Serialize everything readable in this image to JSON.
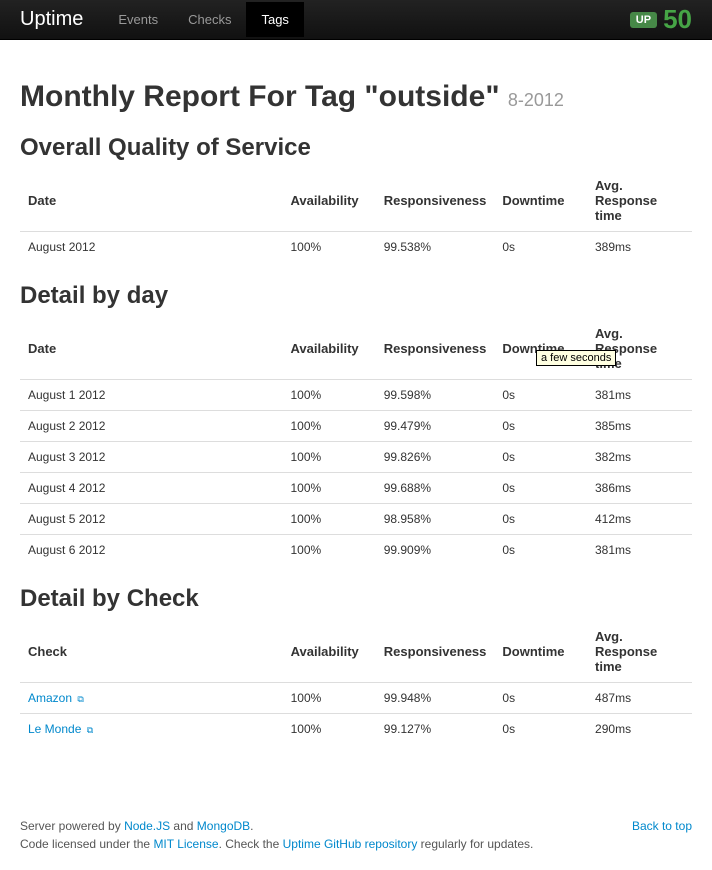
{
  "navbar": {
    "brand": "Uptime",
    "items": [
      {
        "label": "Events",
        "active": false
      },
      {
        "label": "Checks",
        "active": false
      },
      {
        "label": "Tags",
        "active": true
      }
    ],
    "status_badge": "UP",
    "count": "50"
  },
  "heading": {
    "title_prefix": "Monthly Report For Tag \"",
    "tag_name": "outside",
    "title_suffix": "\"",
    "period": "8-2012"
  },
  "sections": {
    "overall": {
      "title": "Overall Quality of Service",
      "columns": [
        "Date",
        "Availability",
        "Responsiveness",
        "Downtime",
        "Avg. Response time"
      ],
      "rows": [
        {
          "c0": "August 2012",
          "c1": "100%",
          "c2": "99.538%",
          "c3": "0s",
          "c4": "389ms"
        }
      ]
    },
    "byday": {
      "title": "Detail by day",
      "columns": [
        "Date",
        "Availability",
        "Responsiveness",
        "Downtime",
        "Avg. Response time"
      ],
      "rows": [
        {
          "c0": "August 1 2012",
          "c1": "100%",
          "c2": "99.598%",
          "c3": "0s",
          "c4": "381ms"
        },
        {
          "c0": "August 2 2012",
          "c1": "100%",
          "c2": "99.479%",
          "c3": "0s",
          "c4": "385ms"
        },
        {
          "c0": "August 3 2012",
          "c1": "100%",
          "c2": "99.826%",
          "c3": "0s",
          "c4": "382ms"
        },
        {
          "c0": "August 4 2012",
          "c1": "100%",
          "c2": "99.688%",
          "c3": "0s",
          "c4": "386ms"
        },
        {
          "c0": "August 5 2012",
          "c1": "100%",
          "c2": "98.958%",
          "c3": "0s",
          "c4": "412ms"
        },
        {
          "c0": "August 6 2012",
          "c1": "100%",
          "c2": "99.909%",
          "c3": "0s",
          "c4": "381ms"
        }
      ]
    },
    "bycheck": {
      "title": "Detail by Check",
      "columns": [
        "Check",
        "Availability",
        "Responsiveness",
        "Downtime",
        "Avg. Response time"
      ],
      "rows": [
        {
          "c0": "Amazon",
          "c1": "100%",
          "c2": "99.948%",
          "c3": "0s",
          "c4": "487ms",
          "link": true
        },
        {
          "c0": "Le Monde",
          "c1": "100%",
          "c2": "99.127%",
          "c3": "0s",
          "c4": "290ms",
          "link": true
        }
      ]
    }
  },
  "tooltip": {
    "text": "a few seconds",
    "visible": true
  },
  "footer": {
    "line1_prefix": "Server powered by ",
    "link_node": "Node.JS",
    "and": " and ",
    "link_mongo": "MongoDB",
    "period": ".",
    "line2_prefix": "Code licensed under the ",
    "link_mit": "MIT License",
    "line2_mid": ". Check the ",
    "link_repo": "Uptime GitHub repository",
    "line2_suffix": " regularly for updates.",
    "back_to_top": "Back to top"
  }
}
